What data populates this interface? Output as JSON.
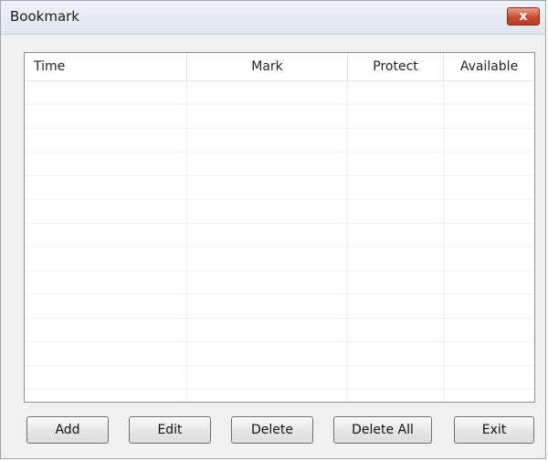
{
  "window": {
    "title": "Bookmark",
    "close_symbol": "x"
  },
  "table": {
    "columns": [
      "Time",
      "Mark",
      "Protect",
      "Available"
    ],
    "rows": []
  },
  "buttons": {
    "add": "Add",
    "edit": "Edit",
    "delete": "Delete",
    "delete_all": "Delete All",
    "exit": "Exit"
  },
  "icons": {
    "close": "close-icon"
  },
  "colors": {
    "close_button": "#c94a2e",
    "background": "#f0f0f0"
  }
}
